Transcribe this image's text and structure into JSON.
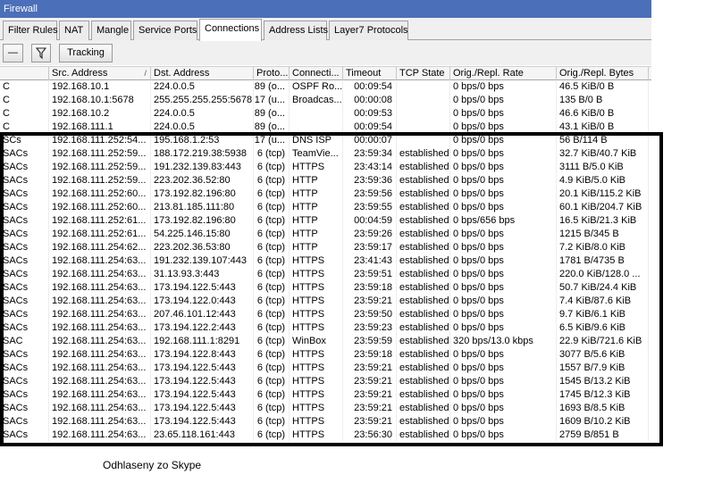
{
  "window": {
    "title": "Firewall"
  },
  "tabs": [
    "Filter Rules",
    "NAT",
    "Mangle",
    "Service Ports",
    "Connections",
    "Address Lists",
    "Layer7 Protocols"
  ],
  "active_tab": "Connections",
  "toolbar": {
    "tracking_label": "Tracking",
    "remove_symbol": "—",
    "filter_symbol": "▽"
  },
  "columns": [
    "",
    "Src. Address",
    "Dst. Address",
    "Proto...",
    "Connecti...",
    "Timeout",
    "TCP State",
    "Orig./Repl. Rate",
    "Orig./Repl. Bytes"
  ],
  "rows": [
    [
      "C",
      "192.168.10.1",
      "224.0.0.5",
      "89 (o...",
      "OSPF Ro...",
      "00:09:54",
      "",
      "0 bps/0 bps",
      "46.5 KiB/0 B"
    ],
    [
      "C",
      "192.168.10.1:5678",
      "255.255.255.255:5678",
      "17 (u...",
      "Broadcas...",
      "00:00:08",
      "",
      "0 bps/0 bps",
      "135 B/0 B"
    ],
    [
      "C",
      "192.168.10.2",
      "224.0.0.5",
      "89 (o...",
      "",
      "00:09:53",
      "",
      "0 bps/0 bps",
      "46.6 KiB/0 B"
    ],
    [
      "C",
      "192.168.111.1",
      "224.0.0.5",
      "89 (o...",
      "",
      "00:09:54",
      "",
      "0 bps/0 bps",
      "43.1 KiB/0 B"
    ],
    [
      "SCs",
      "192.168.111.252:54...",
      "195.168.1.2:53",
      "17 (u...",
      "DNS ISP",
      "00:00:07",
      "",
      "0 bps/0 bps",
      "56 B/114 B"
    ],
    [
      "SACs",
      "192.168.111.252:59...",
      "188.172.219.38:5938",
      "6 (tcp)",
      "TeamVie...",
      "23:59:34",
      "established",
      "0 bps/0 bps",
      "32.7 KiB/40.7 KiB"
    ],
    [
      "SACs",
      "192.168.111.252:59...",
      "191.232.139.83:443",
      "6 (tcp)",
      "HTTPS",
      "23:43:14",
      "established",
      "0 bps/0 bps",
      "3111 B/5.0 KiB"
    ],
    [
      "SACs",
      "192.168.111.252:59...",
      "223.202.36.52:80",
      "6 (tcp)",
      "HTTP",
      "23:59:36",
      "established",
      "0 bps/0 bps",
      "4.9 KiB/5.0 KiB"
    ],
    [
      "SACs",
      "192.168.111.252:60...",
      "173.192.82.196:80",
      "6 (tcp)",
      "HTTP",
      "23:59:56",
      "established",
      "0 bps/0 bps",
      "20.1 KiB/115.2 KiB"
    ],
    [
      "SACs",
      "192.168.111.252:60...",
      "213.81.185.111:80",
      "6 (tcp)",
      "HTTP",
      "23:59:55",
      "established",
      "0 bps/0 bps",
      "60.1 KiB/204.7 KiB"
    ],
    [
      "SACs",
      "192.168.111.252:61...",
      "173.192.82.196:80",
      "6 (tcp)",
      "HTTP",
      "00:04:59",
      "established",
      "0 bps/656 bps",
      "16.5 KiB/21.3 KiB"
    ],
    [
      "SACs",
      "192.168.111.252:61...",
      "54.225.146.15:80",
      "6 (tcp)",
      "HTTP",
      "23:59:26",
      "established",
      "0 bps/0 bps",
      "1215 B/345 B"
    ],
    [
      "SACs",
      "192.168.111.254:62...",
      "223.202.36.53:80",
      "6 (tcp)",
      "HTTP",
      "23:59:17",
      "established",
      "0 bps/0 bps",
      "7.2 KiB/8.0 KiB"
    ],
    [
      "SACs",
      "192.168.111.254:63...",
      "191.232.139.107:443",
      "6 (tcp)",
      "HTTPS",
      "23:41:43",
      "established",
      "0 bps/0 bps",
      "1781 B/4735 B"
    ],
    [
      "SACs",
      "192.168.111.254:63...",
      "31.13.93.3:443",
      "6 (tcp)",
      "HTTPS",
      "23:59:51",
      "established",
      "0 bps/0 bps",
      "220.0 KiB/128.0 ..."
    ],
    [
      "SACs",
      "192.168.111.254:63...",
      "173.194.122.5:443",
      "6 (tcp)",
      "HTTPS",
      "23:59:18",
      "established",
      "0 bps/0 bps",
      "50.7 KiB/24.4 KiB"
    ],
    [
      "SACs",
      "192.168.111.254:63...",
      "173.194.122.0:443",
      "6 (tcp)",
      "HTTPS",
      "23:59:21",
      "established",
      "0 bps/0 bps",
      "7.4 KiB/87.6 KiB"
    ],
    [
      "SACs",
      "192.168.111.254:63...",
      "207.46.101.12:443",
      "6 (tcp)",
      "HTTPS",
      "23:59:50",
      "established",
      "0 bps/0 bps",
      "9.7 KiB/6.1 KiB"
    ],
    [
      "SACs",
      "192.168.111.254:63...",
      "173.194.122.2:443",
      "6 (tcp)",
      "HTTPS",
      "23:59:23",
      "established",
      "0 bps/0 bps",
      "6.5 KiB/9.6 KiB"
    ],
    [
      "SAC",
      "192.168.111.254:63...",
      "192.168.111.1:8291",
      "6 (tcp)",
      "WinBox",
      "23:59:59",
      "established",
      "320 bps/13.0 kbps",
      "22.9 KiB/721.6 KiB"
    ],
    [
      "SACs",
      "192.168.111.254:63...",
      "173.194.122.8:443",
      "6 (tcp)",
      "HTTPS",
      "23:59:18",
      "established",
      "0 bps/0 bps",
      "3077 B/5.6 KiB"
    ],
    [
      "SACs",
      "192.168.111.254:63...",
      "173.194.122.5:443",
      "6 (tcp)",
      "HTTPS",
      "23:59:21",
      "established",
      "0 bps/0 bps",
      "1557 B/7.9 KiB"
    ],
    [
      "SACs",
      "192.168.111.254:63...",
      "173.194.122.5:443",
      "6 (tcp)",
      "HTTPS",
      "23:59:21",
      "established",
      "0 bps/0 bps",
      "1545 B/13.2 KiB"
    ],
    [
      "SACs",
      "192.168.111.254:63...",
      "173.194.122.5:443",
      "6 (tcp)",
      "HTTPS",
      "23:59:21",
      "established",
      "0 bps/0 bps",
      "1745 B/12.3 KiB"
    ],
    [
      "SACs",
      "192.168.111.254:63...",
      "173.194.122.5:443",
      "6 (tcp)",
      "HTTPS",
      "23:59:21",
      "established",
      "0 bps/0 bps",
      "1693 B/8.5 KiB"
    ],
    [
      "SACs",
      "192.168.111.254:63...",
      "173.194.122.5:443",
      "6 (tcp)",
      "HTTPS",
      "23:59:21",
      "established",
      "0 bps/0 bps",
      "1609 B/10.2 KiB"
    ],
    [
      "SACs",
      "192.168.111.254:63...",
      "23.65.118.161:443",
      "6 (tcp)",
      "HTTPS",
      "23:56:30",
      "established",
      "0 bps/0 bps",
      "2759 B/851 B"
    ]
  ],
  "caption": "Odhlaseny zo Skype",
  "colors": {
    "titlebar": "#4b6fb8",
    "highlight_border": "#000000"
  }
}
